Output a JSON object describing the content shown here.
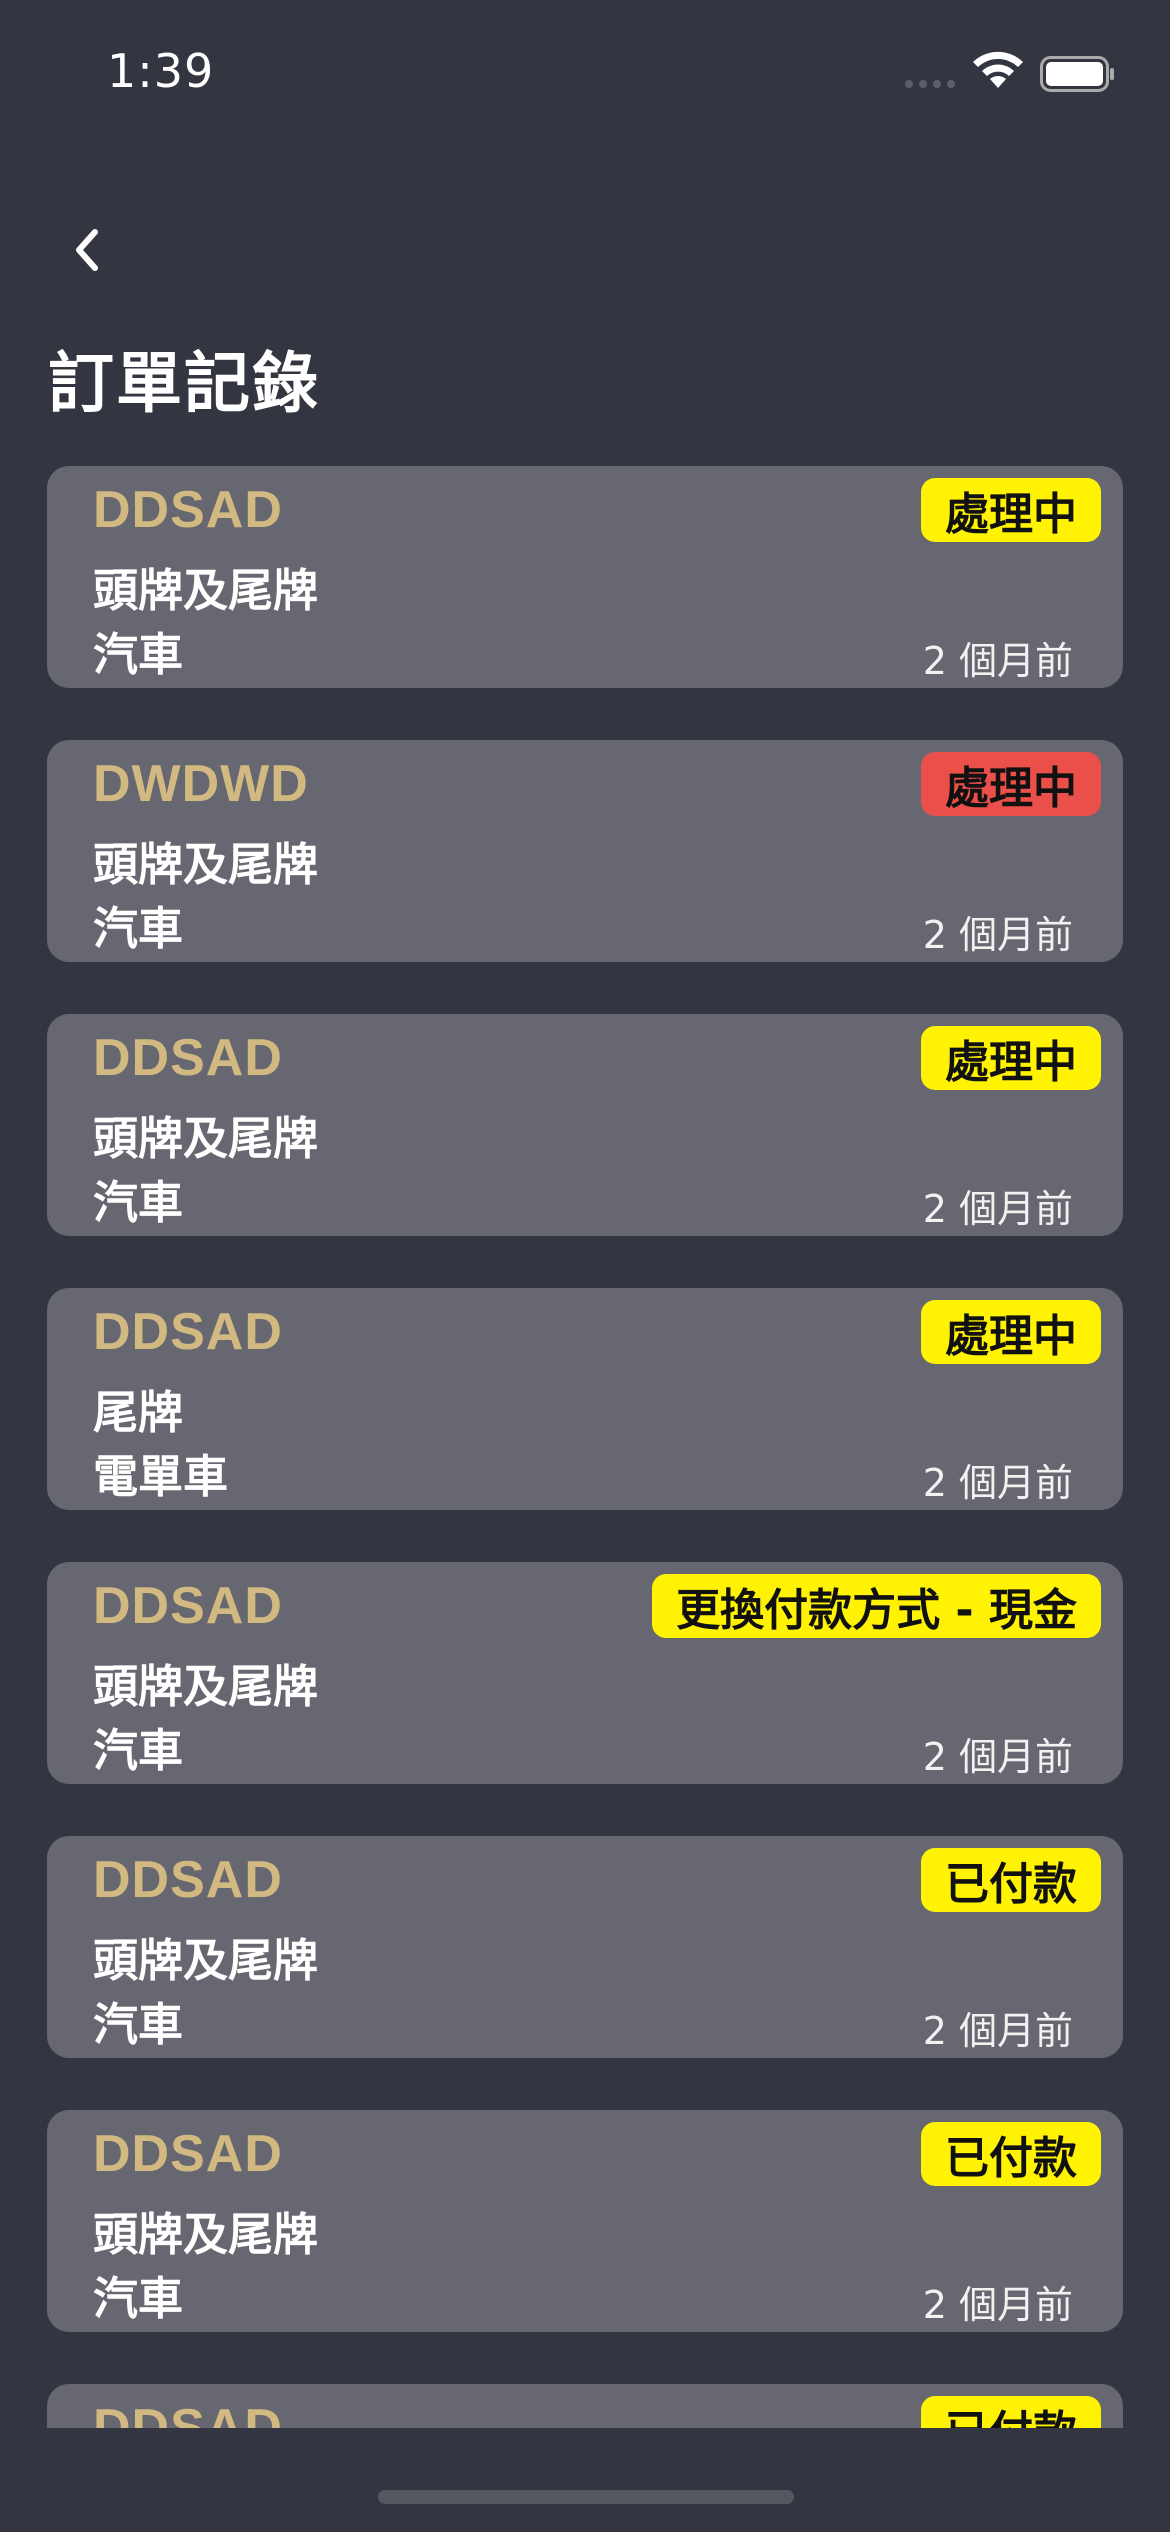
{
  "status_bar": {
    "time": "1:39"
  },
  "header": {
    "title": "訂單記錄"
  },
  "colors": {
    "background": "#333541",
    "card": "#666770",
    "code": "#d2b981",
    "badge_yellow": "#fff203",
    "badge_red": "#ea4f49"
  },
  "orders": [
    {
      "code": "DDSAD",
      "line1": "頭牌及尾牌",
      "line2": "汽車",
      "time": "2 個月前",
      "status": "處理中",
      "status_color": "#fff203"
    },
    {
      "code": "DWDWD",
      "line1": "頭牌及尾牌",
      "line2": "汽車",
      "time": "2 個月前",
      "status": "處理中",
      "status_color": "#ea4f49"
    },
    {
      "code": "DDSAD",
      "line1": "頭牌及尾牌",
      "line2": "汽車",
      "time": "2 個月前",
      "status": "處理中",
      "status_color": "#fff203"
    },
    {
      "code": "DDSAD",
      "line1": "尾牌",
      "line2": "電單車",
      "time": "2 個月前",
      "status": "處理中",
      "status_color": "#fff203"
    },
    {
      "code": "DDSAD",
      "line1": "頭牌及尾牌",
      "line2": "汽車",
      "time": "2 個月前",
      "status": "更換付款方式 - 現金",
      "status_color": "#fff203"
    },
    {
      "code": "DDSAD",
      "line1": "頭牌及尾牌",
      "line2": "汽車",
      "time": "2 個月前",
      "status": "已付款",
      "status_color": "#fff203"
    },
    {
      "code": "DDSAD",
      "line1": "頭牌及尾牌",
      "line2": "汽車",
      "time": "2 個月前",
      "status": "已付款",
      "status_color": "#fff203"
    },
    {
      "code": "DDSAD",
      "line1": "",
      "line2": "",
      "time": "",
      "status": "已付款",
      "status_color": "#fff203"
    }
  ]
}
